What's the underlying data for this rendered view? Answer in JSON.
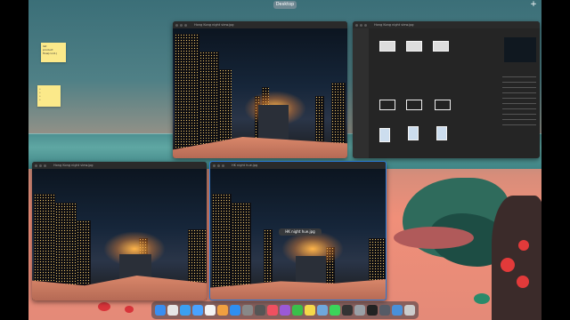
{
  "mission_control": {
    "space_label": "Desktop",
    "add_space_label": "+"
  },
  "stickies": [
    {
      "lines": [
        "list",
        "product flow(cont.)"
      ]
    },
    {
      "lines": [
        "•",
        "•",
        "•",
        "•",
        "•"
      ]
    }
  ],
  "windows": {
    "top_center": {
      "title": "Hong Kong night view.jpg"
    },
    "top_right": {
      "title": "Hong Kong night view.jpg"
    },
    "bottom_left": {
      "title": "Hong Kong night view.jpg"
    },
    "bottom_center": {
      "title": "HK night hue.jpg"
    }
  },
  "drag_label": "HK night hue.jpg",
  "dock": {
    "icons": [
      {
        "name": "finder-icon",
        "color": "#3a8ef0"
      },
      {
        "name": "launchpad-icon",
        "color": "#e6e6e6"
      },
      {
        "name": "safari-icon",
        "color": "#3aa0f0"
      },
      {
        "name": "mail-icon",
        "color": "#4aa3ff"
      },
      {
        "name": "calendar-icon",
        "color": "#f4f4f4"
      },
      {
        "name": "photos-icon",
        "color": "#f0a040"
      },
      {
        "name": "appstore-icon",
        "color": "#2f8ff0"
      },
      {
        "name": "settings-icon",
        "color": "#888888"
      },
      {
        "name": "dictionary-icon",
        "color": "#555555"
      },
      {
        "name": "music-icon",
        "color": "#f05060"
      },
      {
        "name": "podcast-icon",
        "color": "#9b59d6"
      },
      {
        "name": "facetime-icon",
        "color": "#3bbf4a"
      },
      {
        "name": "notes-icon",
        "color": "#f5d94a"
      },
      {
        "name": "preview-icon",
        "color": "#6fa8dc"
      },
      {
        "name": "messages-icon",
        "color": "#3bd45a"
      },
      {
        "name": "calculator-icon",
        "color": "#333333"
      },
      {
        "name": "system-info-icon",
        "color": "#9aa0a6"
      },
      {
        "name": "terminal-icon",
        "color": "#222222"
      },
      {
        "name": "photo-thumb-icon",
        "color": "#555b66"
      },
      {
        "name": "folder-icon",
        "color": "#4a90d9"
      },
      {
        "name": "trash-icon",
        "color": "#cccccc"
      }
    ]
  },
  "colors": {
    "accent": "#2a7bd6",
    "sticky": "#fbe98a"
  }
}
